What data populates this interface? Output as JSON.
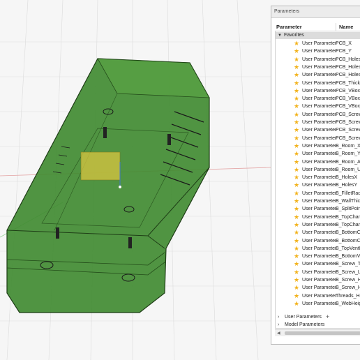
{
  "panel": {
    "title": "Parameters",
    "col_parameter": "Parameter",
    "col_name": "Name",
    "favorites_label": "Favorites",
    "rows": [
      {
        "type": "User Parameter",
        "name": "PCB_X"
      },
      {
        "type": "User Parameter",
        "name": "PCB_Y"
      },
      {
        "type": "User Parameter",
        "name": "PCB_HolesX"
      },
      {
        "type": "User Parameter",
        "name": "PCB_HolesY"
      },
      {
        "type": "User Parameter",
        "name": "PCB_HolesDi"
      },
      {
        "type": "User Parameter",
        "name": "PCB_Thickne"
      },
      {
        "type": "User Parameter",
        "name": "PCB_VBox_G"
      },
      {
        "type": "User Parameter",
        "name": "PCB_VBox_To"
      },
      {
        "type": "User Parameter",
        "name": "PCB_VBox_B"
      },
      {
        "type": "User Parameter",
        "name": "PCB_Screw_T"
      },
      {
        "type": "User Parameter",
        "name": "PCB_Screw_L"
      },
      {
        "type": "User Parameter",
        "name": "PCB_Screw_H"
      },
      {
        "type": "User Parameter",
        "name": "PCB_Screw_H"
      },
      {
        "type": "User Parameter",
        "name": "B_Room_X"
      },
      {
        "type": "User Parameter",
        "name": "B_Room_Y"
      },
      {
        "type": "User Parameter",
        "name": "B_Room_Abo"
      },
      {
        "type": "User Parameter",
        "name": "B_Room_Und"
      },
      {
        "type": "User Parameter",
        "name": "B_HolesX"
      },
      {
        "type": "User Parameter",
        "name": "B_HolesY"
      },
      {
        "type": "User Parameter",
        "name": "B_FilletRadiu"
      },
      {
        "type": "User Parameter",
        "name": "B_WallThickn"
      },
      {
        "type": "User Parameter",
        "name": "B_SplitPoint"
      },
      {
        "type": "User Parameter",
        "name": "B_TopChamf"
      },
      {
        "type": "User Parameter",
        "name": "B_TopChamf"
      },
      {
        "type": "User Parameter",
        "name": "B_BottomCh"
      },
      {
        "type": "User Parameter",
        "name": "B_BottomCh"
      },
      {
        "type": "User Parameter",
        "name": "B_TopVentHo"
      },
      {
        "type": "User Parameter",
        "name": "B_BottomVen"
      },
      {
        "type": "User Parameter",
        "name": "B_Screw_Thr"
      },
      {
        "type": "User Parameter",
        "name": "B_Screw_Len"
      },
      {
        "type": "User Parameter",
        "name": "B_Screw_Hea"
      },
      {
        "type": "User Parameter",
        "name": "B_Screw_Hea"
      },
      {
        "type": "User Parameter",
        "name": "Threads_Heig"
      },
      {
        "type": "User Parameter",
        "name": "B_WebHeigh"
      }
    ],
    "groups": [
      {
        "label": "User Parameters"
      },
      {
        "label": "Model Parameters"
      }
    ]
  },
  "colors": {
    "star": "#f2b21b",
    "model_green": "#3f8f2f",
    "grid": "#d9d9d9"
  }
}
